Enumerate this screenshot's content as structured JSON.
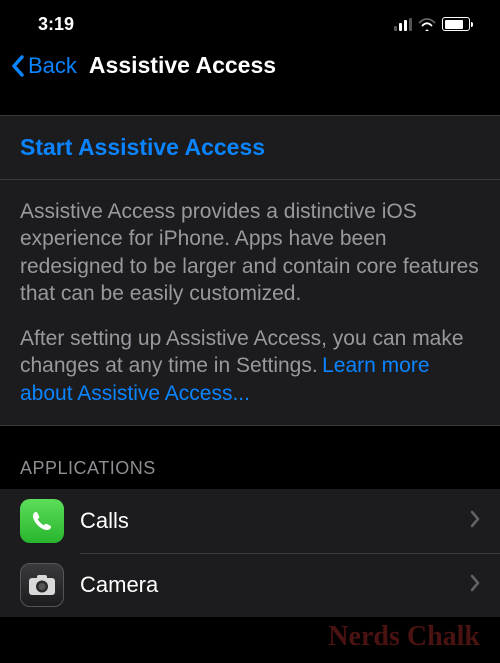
{
  "status": {
    "time": "3:19"
  },
  "nav": {
    "back_label": "Back",
    "title": "Assistive Access"
  },
  "start": {
    "label": "Start Assistive Access"
  },
  "description": {
    "para1": "Assistive Access provides a distinctive iOS experience for iPhone. Apps have been redesigned to be larger and contain core features that can be easily customized.",
    "para2": "After setting up Assistive Access, you can make changes at any time in Settings.",
    "link": "Learn more about Assistive Access..."
  },
  "applications": {
    "header": "APPLICATIONS",
    "items": [
      {
        "label": "Calls"
      },
      {
        "label": "Camera"
      }
    ]
  },
  "watermark": "Nerds Chalk"
}
